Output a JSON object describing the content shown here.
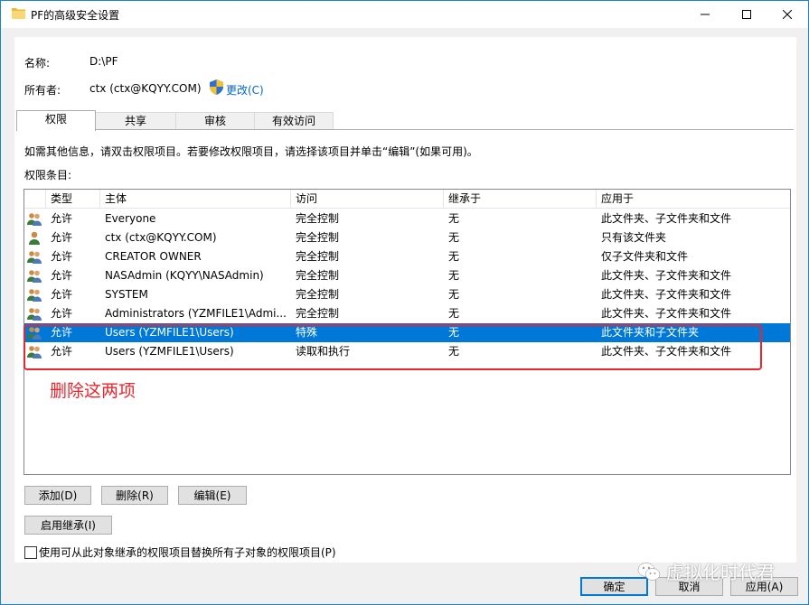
{
  "window": {
    "title": "PF的高级安全设置"
  },
  "info": {
    "name_label": "名称:",
    "name_value": "D:\\PF",
    "owner_label": "所有者:",
    "owner_value": "ctx (ctx@KQYY.COM)",
    "change_link": "更改(C)"
  },
  "tabs": [
    "权限",
    "共享",
    "审核",
    "有效访问"
  ],
  "instructions": "如需其他信息，请双击权限项目。若要修改权限项目，请选择该项目并单击“编辑”(如果可用)。",
  "entries_label": "权限条目:",
  "columns": [
    "类型",
    "主体",
    "访问",
    "继承于",
    "应用于"
  ],
  "rows": [
    {
      "type": "允许",
      "principal": "Everyone",
      "access": "完全控制",
      "inherited": "无",
      "applies": "此文件夹、子文件夹和文件"
    },
    {
      "type": "允许",
      "principal": "ctx (ctx@KQYY.COM)",
      "access": "完全控制",
      "inherited": "无",
      "applies": "只有该文件夹"
    },
    {
      "type": "允许",
      "principal": "CREATOR OWNER",
      "access": "完全控制",
      "inherited": "无",
      "applies": "仅子文件夹和文件"
    },
    {
      "type": "允许",
      "principal": "NASAdmin (KQYY\\NASAdmin)",
      "access": "完全控制",
      "inherited": "无",
      "applies": "此文件夹、子文件夹和文件"
    },
    {
      "type": "允许",
      "principal": "SYSTEM",
      "access": "完全控制",
      "inherited": "无",
      "applies": "此文件夹、子文件夹和文件"
    },
    {
      "type": "允许",
      "principal": "Administrators (YZMFILE1\\Admi...",
      "access": "完全控制",
      "inherited": "无",
      "applies": "此文件夹、子文件夹和文件"
    },
    {
      "type": "允许",
      "principal": "Users (YZMFILE1\\Users)",
      "access": "特殊",
      "inherited": "无",
      "applies": "此文件夹和子文件夹"
    },
    {
      "type": "允许",
      "principal": "Users (YZMFILE1\\Users)",
      "access": "读取和执行",
      "inherited": "无",
      "applies": "此文件夹、子文件夹和文件"
    }
  ],
  "selected_row": 6,
  "annotation": "删除这两项",
  "buttons": {
    "add": "添加(D)",
    "remove": "删除(R)",
    "edit": "编辑(E)",
    "enable_inherit": "启用继承(I)",
    "ok": "确定",
    "cancel": "取消",
    "apply": "应用(A)"
  },
  "replace_checkbox": {
    "label": "使用可从此对象继承的权限项目替换所有子对象的权限项目(P)",
    "checked": false
  },
  "watermark": "虚拟化时代君",
  "colors": {
    "selection": "#0078d7",
    "annotation": "#e8262e",
    "link": "#0066cc"
  }
}
